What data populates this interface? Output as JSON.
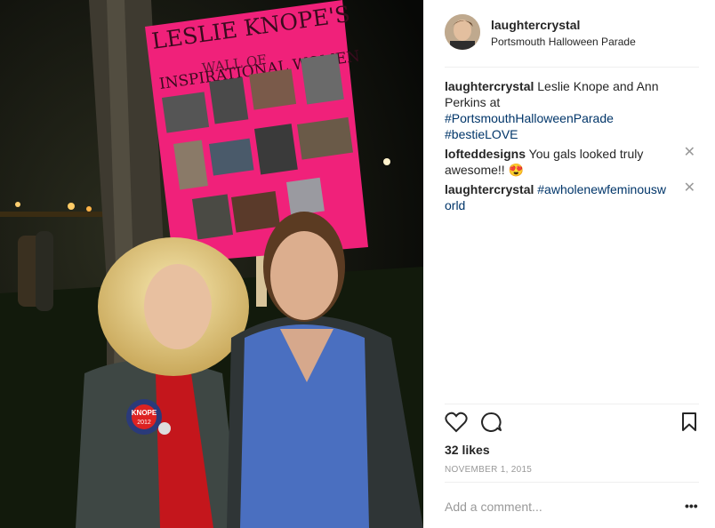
{
  "post": {
    "username": "laughtercrystal",
    "location": "Portsmouth Halloween Parade",
    "likes_text": "32 likes",
    "date": "NOVEMBER 1, 2015",
    "add_comment_placeholder": "Add a comment...",
    "more_label": "•••"
  },
  "comments": [
    {
      "user": "laughtercrystal",
      "text_plain": "Leslie Knope and Ann Perkins at ",
      "tag1": "#PortsmouthHalloweenParade",
      "tag2": "#bestieLOVE"
    },
    {
      "user": "loftedesigns",
      "user_display": "lofteddesigns",
      "text": "You gals looked truly awesome!! 😍",
      "close": "✕"
    },
    {
      "user": "laughtercrystal",
      "tag": "#awholenewfeminousworld",
      "close": "✕"
    }
  ],
  "photo": {
    "sign_line1": "LESLIE KNOPE'S",
    "sign_line2": "WALL OF",
    "sign_line3": "INSPIRATIONAL WOMEN",
    "button_line1": "KNOPE",
    "button_line2": "2012"
  },
  "icons": {
    "heart": "heart-icon",
    "comment": "comment-icon",
    "bookmark": "bookmark-icon"
  },
  "colors": {
    "sign_pink": "#f0217a",
    "hashtag": "#003569"
  }
}
